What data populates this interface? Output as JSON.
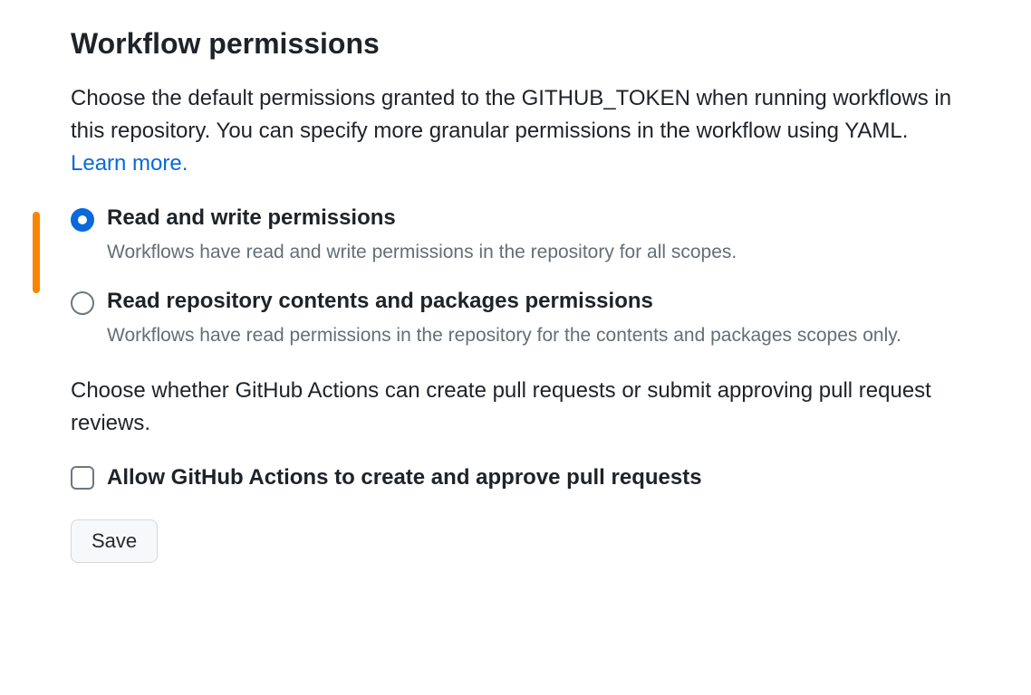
{
  "section": {
    "title": "Workflow permissions",
    "description": "Choose the default permissions granted to the GITHUB_TOKEN when running workflows in this repository. You can specify more granular permissions in the workflow using YAML. ",
    "learn_more": "Learn more."
  },
  "radio_options": [
    {
      "label": "Read and write permissions",
      "description": "Workflows have read and write permissions in the repository for all scopes.",
      "selected": true
    },
    {
      "label": "Read repository contents and packages permissions",
      "description": "Workflows have read permissions in the repository for the contents and packages scopes only.",
      "selected": false
    }
  ],
  "checkbox_section": {
    "description": "Choose whether GitHub Actions can create pull requests or submit approving pull request reviews.",
    "label": "Allow GitHub Actions to create and approve pull requests",
    "checked": false
  },
  "save_button": "Save"
}
